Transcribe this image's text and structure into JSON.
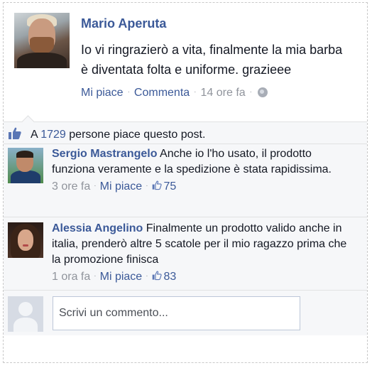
{
  "post": {
    "author": "Mario Aperuta",
    "text": "Io vi ringrazierò a vita, finalmente la mia barba è diventata folta e uniforme. grazieee",
    "like_label": "Mi piace",
    "comment_label": "Commenta",
    "time": "14 ore fa",
    "separator": "·"
  },
  "likes": {
    "prefix": "A ",
    "count": "1729",
    "suffix": " persone piace questo post."
  },
  "comments": [
    {
      "author": "Sergio Mastrangelo",
      "text": " Anche io l'ho usato, il prodotto funziona veramente e la spedizione è stata rapidissima.",
      "time": "3 ore fa",
      "like_label": "Mi piace",
      "like_count": "75"
    },
    {
      "author": "Alessia Angelino",
      "text": " Finalmente un prodotto valido anche in italia, prenderò altre 5 scatole per il mio ragazzo prima che la promozione finisca",
      "time": "1 ora fa",
      "like_label": "Mi piace",
      "like_count": "83"
    }
  ],
  "composer": {
    "placeholder": "Scrivi un commento..."
  },
  "colors": {
    "link": "#3b5998",
    "meta": "#90949c",
    "feedback_bg": "#f6f7f9"
  },
  "icons": [
    "globe-icon",
    "thumbs-up-icon"
  ]
}
